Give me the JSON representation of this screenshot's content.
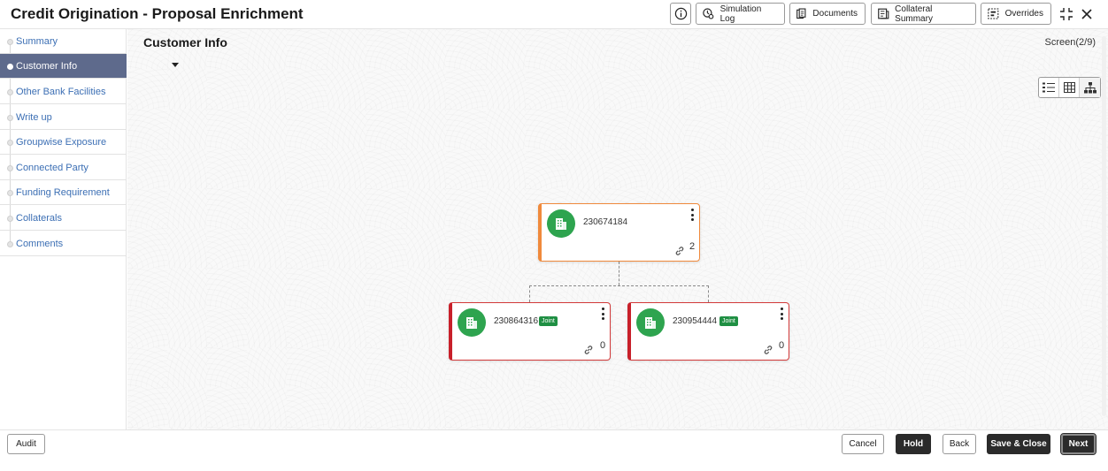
{
  "header": {
    "title": "Credit Origination - Proposal Enrichment",
    "buttons": {
      "info_icon": "info-icon",
      "simulation_log": "Simulation Log",
      "documents": "Documents",
      "collateral_summary": "Collateral Summary",
      "overrides": "Overrides"
    },
    "icons": [
      "info-icon",
      "simulation-log-icon",
      "documents-icon",
      "collateral-summary-icon",
      "overrides-icon",
      "collapse-icon",
      "close-icon"
    ]
  },
  "sidebar": {
    "items": [
      {
        "label": "Summary",
        "active": false
      },
      {
        "label": "Customer Info",
        "active": true
      },
      {
        "label": "Other Bank Facilities",
        "active": false
      },
      {
        "label": "Write up",
        "active": false
      },
      {
        "label": "Groupwise Exposure",
        "active": false
      },
      {
        "label": "Connected Party",
        "active": false
      },
      {
        "label": "Funding Requirement",
        "active": false
      },
      {
        "label": "Collaterals",
        "active": false
      },
      {
        "label": "Comments",
        "active": false
      }
    ]
  },
  "main": {
    "title": "Customer Info",
    "screen_counter": "Screen(2/9)",
    "view_modes": [
      "list-view-icon",
      "table-view-icon",
      "hierarchy-view-icon"
    ],
    "org_chart": {
      "root": {
        "id": "230674184",
        "link_count": "2",
        "icon": "building-icon"
      },
      "children": [
        {
          "id": "230864316",
          "badge": "Joint",
          "link_count": "0",
          "icon": "building-icon"
        },
        {
          "id": "230954444",
          "badge": "Joint",
          "link_count": "0",
          "icon": "building-icon"
        }
      ]
    }
  },
  "footer": {
    "audit": "Audit",
    "cancel": "Cancel",
    "hold": "Hold",
    "back": "Back",
    "save_close": "Save & Close",
    "next": "Next"
  },
  "colors": {
    "sidebar_active_bg": "#5e6a8c",
    "link_text": "#3c6fb4",
    "primary_card_border": "#f08a3c",
    "joint_card_border": "#c8202a",
    "avatar_green": "#2ea44f",
    "badge_green": "#1f8f43",
    "dark_button": "#2b2b2b"
  }
}
